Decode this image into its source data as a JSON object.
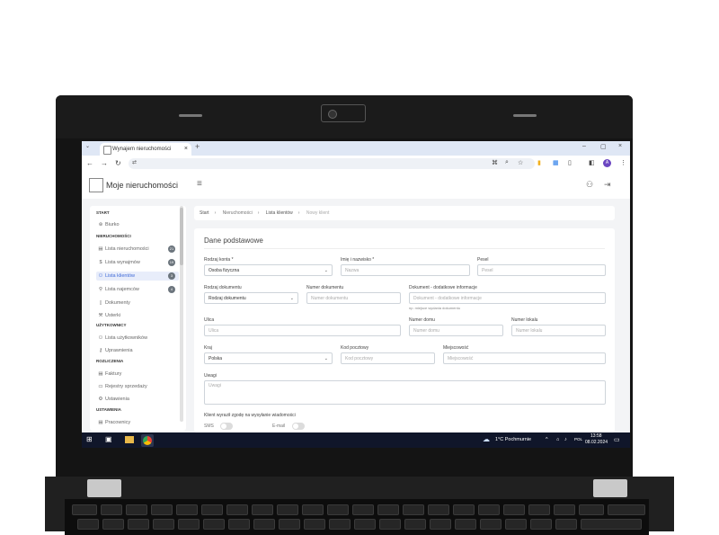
{
  "browser": {
    "tab_title": "Wynajem nieruchomości",
    "tab_close": "×",
    "new_tab": "+",
    "window_controls": [
      "–",
      "▢",
      "×"
    ],
    "profile_initial": "A"
  },
  "app": {
    "brand": "Moje nieruchomości"
  },
  "sidebar": {
    "sections": [
      {
        "title": "START",
        "items": [
          {
            "label": "Biurko",
            "icon": "desk-icon"
          }
        ]
      },
      {
        "title": "NIERUCHOMOŚCI",
        "items": [
          {
            "label": "Lista nieruchomości",
            "icon": "building-icon",
            "badge": "21"
          },
          {
            "label": "Lista wynajmów",
            "icon": "dollar-icon",
            "badge": "19"
          },
          {
            "label": "Lista klientów",
            "icon": "users-icon",
            "badge": "3",
            "active": true
          },
          {
            "label": "Lista najemców",
            "icon": "person-icon",
            "badge": "4"
          },
          {
            "label": "Dokumenty",
            "icon": "document-icon"
          },
          {
            "label": "Usterki",
            "icon": "wrench-icon"
          }
        ]
      },
      {
        "title": "UŻYTKOWNICY",
        "items": [
          {
            "label": "Lista użytkowników",
            "icon": "user-list-icon"
          },
          {
            "label": "Uprawnienia",
            "icon": "key-icon"
          }
        ]
      },
      {
        "title": "ROZLICZENIA",
        "items": [
          {
            "label": "Faktury",
            "icon": "invoice-icon"
          },
          {
            "label": "Rejestry sprzedaży",
            "icon": "folder-icon"
          },
          {
            "label": "Ustawienia",
            "icon": "gear-icon"
          }
        ]
      },
      {
        "title": "USTAWIENIA",
        "items": [
          {
            "label": "Pracownicy",
            "icon": "staff-icon"
          }
        ]
      }
    ]
  },
  "breadcrumb": [
    "Start",
    "Nieruchomości",
    "Lista klientów",
    "Nowy klient"
  ],
  "form": {
    "title": "Dane podstawowe",
    "account_type": {
      "label": "Rodzaj konta *",
      "value": "Osoba fizyczna"
    },
    "name": {
      "label": "Imię i nazwisko *",
      "placeholder": "Nazwa"
    },
    "pesel": {
      "label": "Pesel",
      "placeholder": "Pesel"
    },
    "doc_type": {
      "label": "Rodzaj dokumentu",
      "value": "Rodzaj dokumentu"
    },
    "doc_number": {
      "label": "Numer dokumentu",
      "placeholder": "Numer dokumentu"
    },
    "doc_info": {
      "label": "Dokument - dodatkowe informacje",
      "placeholder": "Dokument - dodatkowe informacje",
      "hint": "np. miejsce wydania dokumentu"
    },
    "street": {
      "label": "Ulica",
      "placeholder": "Ulica"
    },
    "house_no": {
      "label": "Numer domu",
      "placeholder": "Numer domu"
    },
    "flat_no": {
      "label": "Numer lokalu",
      "placeholder": "Numer lokalu"
    },
    "country": {
      "label": "Kraj",
      "value": "Polska"
    },
    "postcode": {
      "label": "Kod pocztowy",
      "placeholder": "Kod pocztowy"
    },
    "city": {
      "label": "Miejscowość",
      "placeholder": "Miejscowość"
    },
    "notes": {
      "label": "Uwagi",
      "placeholder": "Uwagi"
    },
    "consent_label": "Klient wyraził zgodę na wysyłanie wiadomości",
    "sms_label": "SMS",
    "email_label": "E-mail"
  },
  "taskbar": {
    "weather": "1°C  Pochmurnie",
    "time": "13:58",
    "date": "08.02.2024",
    "lang": "POL"
  }
}
